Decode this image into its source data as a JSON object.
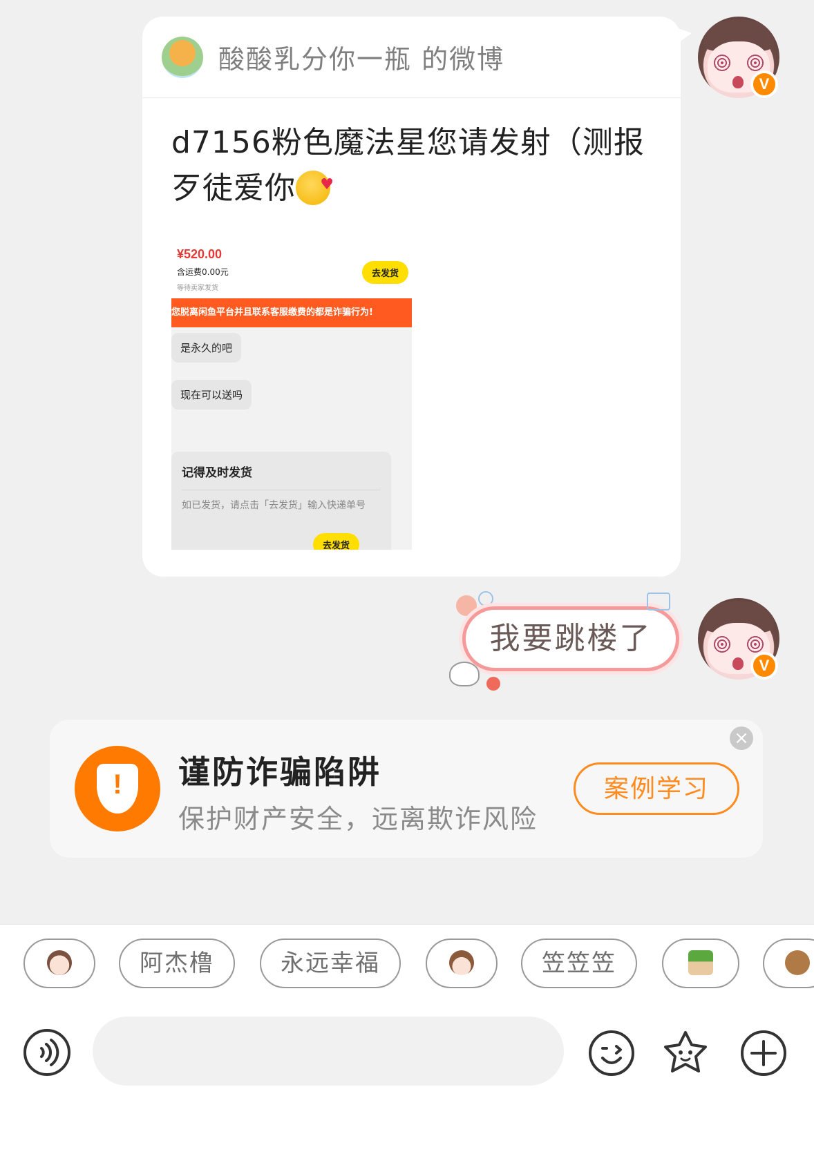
{
  "shared_card": {
    "source": "酸酸乳分你一瓶 的微博",
    "text": "d7156粉色魔法星您请发射（测报歹徒爱你",
    "screenshot": {
      "price": "¥520.00",
      "fee": "含运费0.00元",
      "status": "等待卖家发货",
      "ship_btn": "去发货",
      "warning": "您脱离闲鱼平台并且联系客服缴费的都是诈骗行为!",
      "bubble1": "是永久的吧",
      "bubble2": "现在可以送吗",
      "card_title": "记得及时发货",
      "card_body": "如已发货，请点击「去发货」输入快递单号",
      "card_btn": "去发货"
    }
  },
  "sticker_message": {
    "text": "我要跳楼了"
  },
  "fraud_warning": {
    "title": "谨防诈骗陷阱",
    "subtitle": "保护财产安全，远离欺诈风险",
    "button": "案例学习"
  },
  "quick_chips": [
    "阿杰橹",
    "永远幸福",
    "笠笠笠"
  ],
  "colors": {
    "accent_orange": "#ff8a1e",
    "warning_red": "#ff5a1f",
    "price_red": "#e53935",
    "sticker_pink": "#f49a9a"
  },
  "icons": [
    "verified-badge-icon",
    "shield-alert-icon",
    "close-icon",
    "voice-icon",
    "emoji-icon",
    "sticker-icon",
    "plus-icon"
  ]
}
